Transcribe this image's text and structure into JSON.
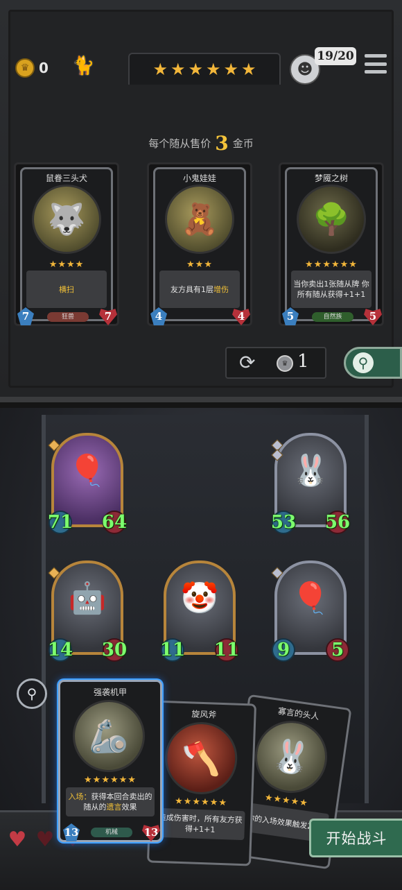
{
  "hud": {
    "gold": "0",
    "population": "19/20",
    "tier_stars": 6,
    "icons": [
      "coin-icon",
      "cat-icon",
      "player-avatar",
      "menu-icon"
    ]
  },
  "shop": {
    "price_prefix": "每个随从售价",
    "price_value": "3",
    "price_suffix": "金币",
    "cards": [
      {
        "name": "鼠眷三头犬",
        "stars": "★★★★",
        "text_plain": "横扫",
        "text_highlight": "",
        "tribe": "狂兽",
        "tribe_color": "#7a3a33",
        "attack": "7",
        "health": "7"
      },
      {
        "name": "小鬼娃娃",
        "stars": "★★★",
        "text_plain": "友方具有1层",
        "text_highlight": "增伤",
        "tribe": "",
        "tribe_color": "",
        "attack": "4",
        "health": "4"
      },
      {
        "name": "梦魇之树",
        "stars": "★★★★★★",
        "text_plain": "当你卖出1张随从牌 你所有随从获得+1+1",
        "text_highlight": "",
        "tribe": "自然族",
        "tribe_color": "#2f5e2c",
        "attack": "5",
        "health": "5"
      }
    ],
    "refresh_cost": "1"
  },
  "board": {
    "minions": [
      {
        "icon": "zeppelin",
        "attack": "71",
        "health": "64"
      },
      {
        "icon": "rabbit-mask",
        "attack": "53",
        "health": "56"
      },
      {
        "icon": "robot",
        "attack": "14",
        "health": "30"
      },
      {
        "icon": "clown",
        "attack": "11",
        "health": "11"
      },
      {
        "icon": "zeppelin",
        "attack": "9",
        "health": "5"
      }
    ]
  },
  "hand": {
    "cards": [
      {
        "name": "强袭机甲",
        "stars": "★★★★★★",
        "text_hl": "入场：",
        "text_plain": "获得本回合卖出的随从的",
        "text_hl2": "遗言",
        "text_plain2": "效果",
        "tribe": "机械",
        "attack": "13",
        "health": "13"
      },
      {
        "name": "旋风斧",
        "stars": "★★★★★★",
        "text_plain": "造成伤害时，所有友方获得+1+1"
      },
      {
        "name": "寡言的头人",
        "stars": "★★★★★",
        "text_plain": "你的入场效果触发2次"
      }
    ]
  },
  "lives": [
    "♥",
    "♥",
    "♥"
  ],
  "start_button": "开始战斗",
  "colors": {
    "gold": "#f2b63a",
    "stat_green": "#7dff6e",
    "attack_blue": "#3b7fbf",
    "health_red": "#b6313a",
    "start_green": "#2f6a4f"
  }
}
